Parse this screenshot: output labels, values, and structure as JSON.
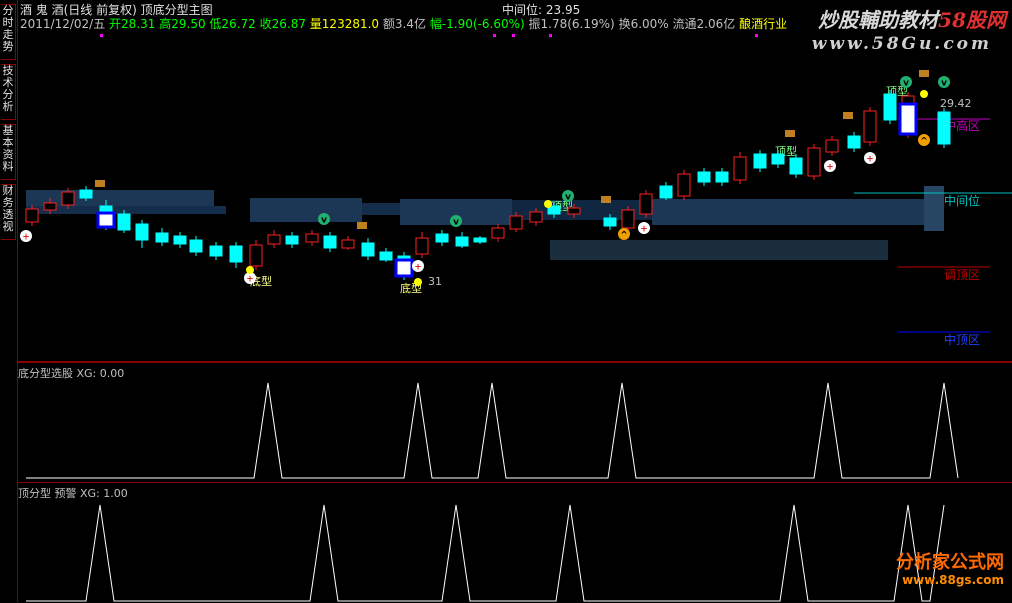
{
  "side_tabs": [
    "分时走势",
    "技术分析",
    "基本资料",
    "财务透视"
  ],
  "header": {
    "line1_name": "酒 鬼 酒(日线 前复权) 顶底分型主图",
    "line1_mid_label": "中间位: 23.95",
    "line2_date": "2011/12/02/五",
    "line2_open": "开28.31",
    "line2_high": "高29.50",
    "line2_low": "低26.72",
    "line2_close": "收26.87",
    "line2_vol": "量123281.0",
    "line2_amount": "额3.4亿",
    "line2_change": "幅-1.90(-6.60%)",
    "line2_amp": "振1.78(6.19%)",
    "line2_turnover": "换6.00%",
    "line2_float": "流通2.06亿",
    "line2_industry": "酿酒行业"
  },
  "watermarks": {
    "top_a": "炒股輔助教材",
    "top_b": "58股网",
    "top_url": "www.58Gu.com",
    "bottom_name": "分析家公式网",
    "bottom_url": "www.88gs.com"
  },
  "main_chart": {
    "price_tag": "29.42",
    "low_tag": "31",
    "zone_labels": [
      "中高区",
      "中间位",
      "调顶区",
      "中顶区"
    ],
    "pattern_labels": [
      "顶型",
      "顶型",
      "顶型",
      "底型",
      "底型"
    ]
  },
  "panel2": {
    "title": "底分型选股",
    "value": "XG: 0.00"
  },
  "panel3": {
    "title": "顶分型 预警",
    "value": "XG: 1.00"
  },
  "colors": {
    "up": "#ff2020",
    "down": "#00ffff",
    "zone": "#1e3a5a",
    "grid": "#8b0000"
  }
}
